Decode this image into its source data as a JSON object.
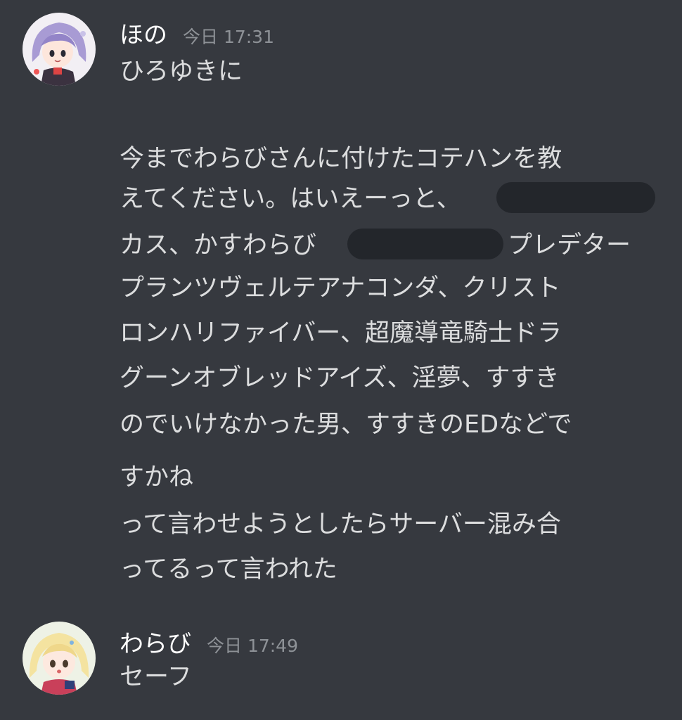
{
  "colors": {
    "background": "#36393f",
    "message_text": "#dcddde",
    "username": "#ffffff",
    "timestamp": "#8e9297",
    "redaction": "#23262b"
  },
  "messages": [
    {
      "avatar_icon": "anime-girl-purple-hair-avatar",
      "username": "ほの",
      "timestamp": "今日 17:31",
      "lines": [
        "ひろゆきに",
        "今までわらびさんに付けたコテハンを教",
        "えてください。はいえーっと、",
        "カス、かすわらび",
        "プレデター",
        "プランツヴェルテアナコンダ、クリスト",
        "ロンハリファイバー、超魔導竜騎士ドラ",
        "グーンオブレッドアイズ、淫夢、すすき",
        "のでいけなかった男、すすきのEDなどで",
        "すかね",
        "って言わせようとしたらサーバー混み合",
        "ってるって言われた"
      ]
    },
    {
      "avatar_icon": "anime-girl-blonde-hair-avatar",
      "username": "わらび",
      "timestamp": "今日 17:49",
      "lines": [
        "セーフ"
      ]
    }
  ]
}
